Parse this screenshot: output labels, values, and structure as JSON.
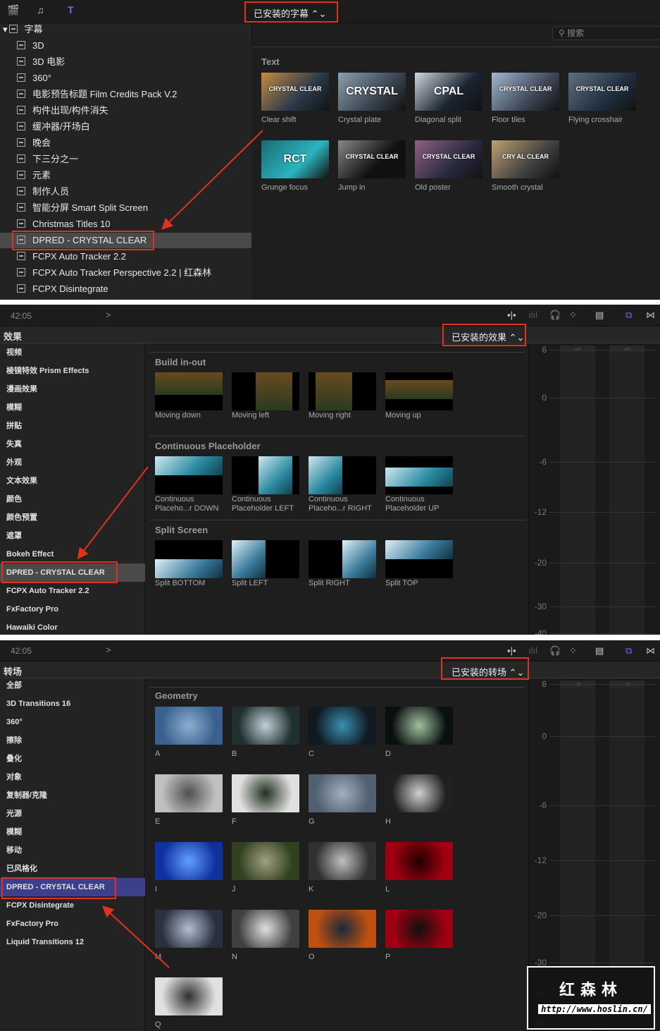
{
  "titles_panel": {
    "toolbar_icons": [
      "clapper-star-icon",
      "music-camera-icon",
      "titles-icon"
    ],
    "dropdown": "已安装的字幕 ⌃⌄",
    "search_placeholder": "搜索",
    "root": "字幕",
    "sidebar": [
      "3D",
      "3D 电影",
      "360°",
      "电影预告标题 Film Credits Pack V.2",
      "构件出现/构件消失",
      "缓冲器/开场白",
      "晚会",
      "下三分之一",
      "元素",
      "制作人员",
      "智能分屏 Smart Split Screen",
      "Christmas Titles 10",
      "DPRED - CRYSTAL CLEAR",
      "FCPX Auto Tracker 2.2",
      "FCPX Auto Tracker Perspective 2.2 | 红森林",
      "FCPX Disintegrate"
    ],
    "selected_index": 12,
    "section": "Text",
    "items": [
      {
        "label": "Clear shift",
        "thumb_text": "CRYSTAL CLEAR"
      },
      {
        "label": "Crystal plate",
        "thumb_text": "CRYSTAL"
      },
      {
        "label": "Diagonal split",
        "thumb_text": "CPAL"
      },
      {
        "label": "Floor tiles",
        "thumb_text": "CRYSTAL CLEAR"
      },
      {
        "label": "Flying crosshair",
        "thumb_text": "CRYSTAL CLEAR"
      },
      {
        "label": "Grunge focus",
        "thumb_text": "RCT"
      },
      {
        "label": "Jump in",
        "thumb_text": "CRYSTAL CLEAR"
      },
      {
        "label": "Old poster",
        "thumb_text": "CRYSTAL CLEAR"
      },
      {
        "label": "Smooth crystal",
        "thumb_text": "CRY  AL CLEAR"
      }
    ]
  },
  "effects_panel": {
    "timecode": "42:05",
    "chevron": ">",
    "title": "效果",
    "dropdown": "已安装的效果 ⌃⌄",
    "sidebar": [
      "视频",
      "棱镜特效 Prism Effects",
      "漫画效果",
      "模糊",
      "拼贴",
      "失真",
      "外观",
      "文本效果",
      "颜色",
      "颜色预置",
      "遮罩",
      "Bokeh Effect",
      "DPRED - CRYSTAL CLEAR",
      "FCPX Auto Tracker 2.2",
      "FxFactory Pro",
      "Hawaiki Color"
    ],
    "selected_index": 12,
    "sections": [
      {
        "title": "Build in-out",
        "items": [
          "Moving down",
          "Moving left",
          "Moving right",
          "Moving up"
        ]
      },
      {
        "title": "Continuous Placeholder",
        "items": [
          "Continuous\nPlaceho...r DOWN",
          "Continuous\nPlaceholder LEFT",
          "Continuous\nPlaceho...r RIGHT",
          "Continuous\nPlaceholder UP"
        ]
      },
      {
        "title": "Split Screen",
        "items": [
          "Split BOTTOM",
          "Split LEFT",
          "Split RIGHT",
          "Split TOP"
        ]
      }
    ],
    "meter_peaks": [
      "-∞",
      "-∞"
    ],
    "meter_scale": [
      "6",
      "0",
      "-6",
      "-12",
      "-20",
      "-30",
      "-40"
    ]
  },
  "transitions_panel": {
    "timecode": "42:05",
    "chevron": ">",
    "title": "转场",
    "dropdown": "已安装的转场 ⌃⌄",
    "sidebar": [
      "全部",
      "3D Transitions 16",
      "360°",
      "擦除",
      "叠化",
      "对象",
      "复制器/克隆",
      "光源",
      "模糊",
      "移动",
      "已风格化",
      "DPRED - CRYSTAL CLEAR",
      "FCPX Disintegrate",
      "FxFactory Pro",
      "Liquid Transitions 12"
    ],
    "selected_index": 11,
    "section": "Geometry",
    "items": [
      "A",
      "B",
      "C",
      "D",
      "E",
      "F",
      "G",
      "H",
      "I",
      "J",
      "K",
      "L",
      "M",
      "N",
      "O",
      "P",
      "Q"
    ],
    "meter_peaks": [
      "-∞",
      "-∞"
    ],
    "meter_scale": [
      "6",
      "0",
      "-6",
      "-12",
      "-20",
      "-30",
      "-40",
      "-50",
      "-60"
    ]
  },
  "watermark": {
    "name": "红森林",
    "url": "http://www.hoslin.cn/"
  },
  "colors": {
    "annotation": "#e0321e",
    "selected_gray": "#4a4a4a",
    "selected_blue": "#3b3f8c",
    "accent": "#5b5bd6"
  }
}
